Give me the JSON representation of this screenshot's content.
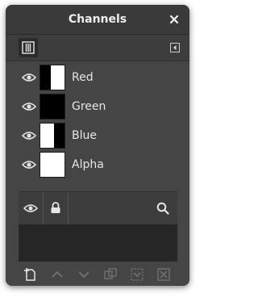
{
  "window": {
    "title": "Channels"
  },
  "channels": [
    {
      "label": "Red"
    },
    {
      "label": "Green"
    },
    {
      "label": "Blue"
    },
    {
      "label": "Alpha"
    }
  ],
  "icons": {
    "close": "close-icon",
    "tab": "channels-tab-icon",
    "tab_menu": "tab-menu-icon",
    "visibility": "eye-icon",
    "lock": "lock-icon",
    "search": "search-icon",
    "new_channel": "new-channel-icon",
    "raise": "chevron-up-icon",
    "lower": "chevron-down-icon",
    "duplicate": "duplicate-icon",
    "to_selection": "channel-to-selection-icon",
    "delete": "delete-icon"
  },
  "colors": {
    "panel_bg": "#454545",
    "title_bg": "#3a3a3a",
    "text": "#e6e6e6",
    "empty_area": "#262626"
  }
}
